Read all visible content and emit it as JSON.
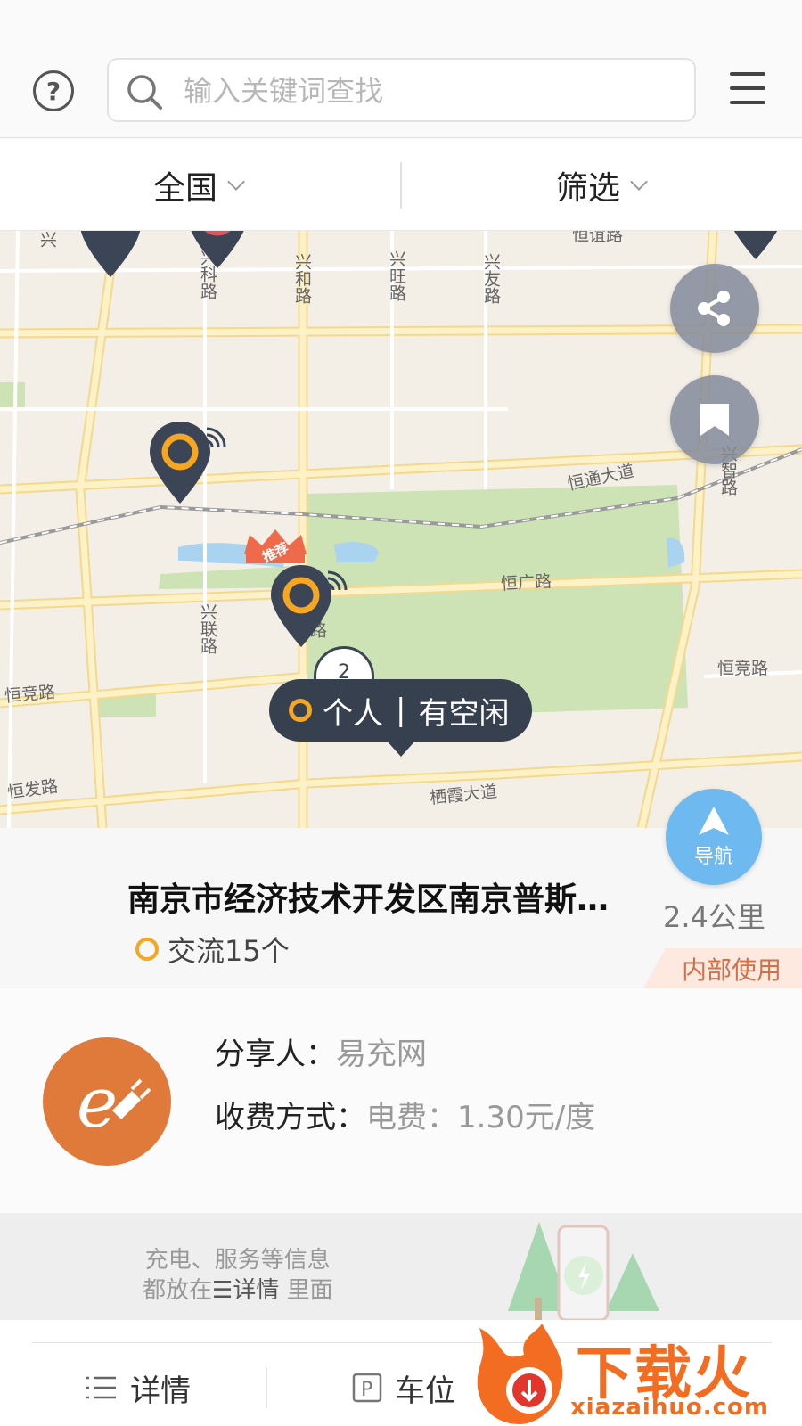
{
  "header": {
    "help_icon": "question-circle-icon",
    "search": {
      "placeholder": "输入关键词查找",
      "value": ""
    },
    "menu_icon": "hamburger-menu-icon"
  },
  "filters": {
    "region_label": "全国",
    "filter_label": "筛选"
  },
  "map": {
    "road_labels": {
      "hengtong": "恒通大道",
      "hengguang": "恒广路",
      "hengjing_right": "恒竞路",
      "hengjing_left": "恒竞路",
      "hengfa": "恒发路",
      "qixia": "栖霞大道",
      "xingke": "兴科路",
      "xinghe": "兴和路",
      "xingwang": "兴旺路",
      "xingyou": "兴友路",
      "xinglian": "兴联路",
      "hengyi": "恒谊路",
      "xingzhi": "兴智路",
      "partial_xing": "兴",
      "zhi_lu": "路"
    },
    "recommend_badge": "推荐",
    "cluster_count": "2",
    "popup": {
      "type_label": "个人",
      "separator": "|",
      "status_label": "有空闲"
    },
    "share_icon": "share-icon",
    "bookmark_icon": "bookmark-icon",
    "colors": {
      "pin": "#3c4556",
      "ring": "#f5a623",
      "park": "#cde3b5",
      "road": "#fde7a9"
    }
  },
  "station": {
    "name": "南京市经济技术开发区南京普斯…",
    "distance": "2.4公里",
    "ac_label": "交流15个",
    "tag": "内部使用",
    "nav_label": "导航"
  },
  "sharer": {
    "sharer_label": "分享人：",
    "sharer_value": "易充网",
    "fee_label": "收费方式：",
    "fee_value": "电费：1.30元/度"
  },
  "tip": {
    "line1": "充电、服务等信息",
    "line2_prefix": "都放在",
    "line2_strong": "☰详情",
    "line2_suffix": " 里面"
  },
  "tabs": {
    "details": "详情",
    "parking": "车位"
  },
  "watermark": {
    "brand": "下载火",
    "url": "xiazaihuo.com"
  }
}
